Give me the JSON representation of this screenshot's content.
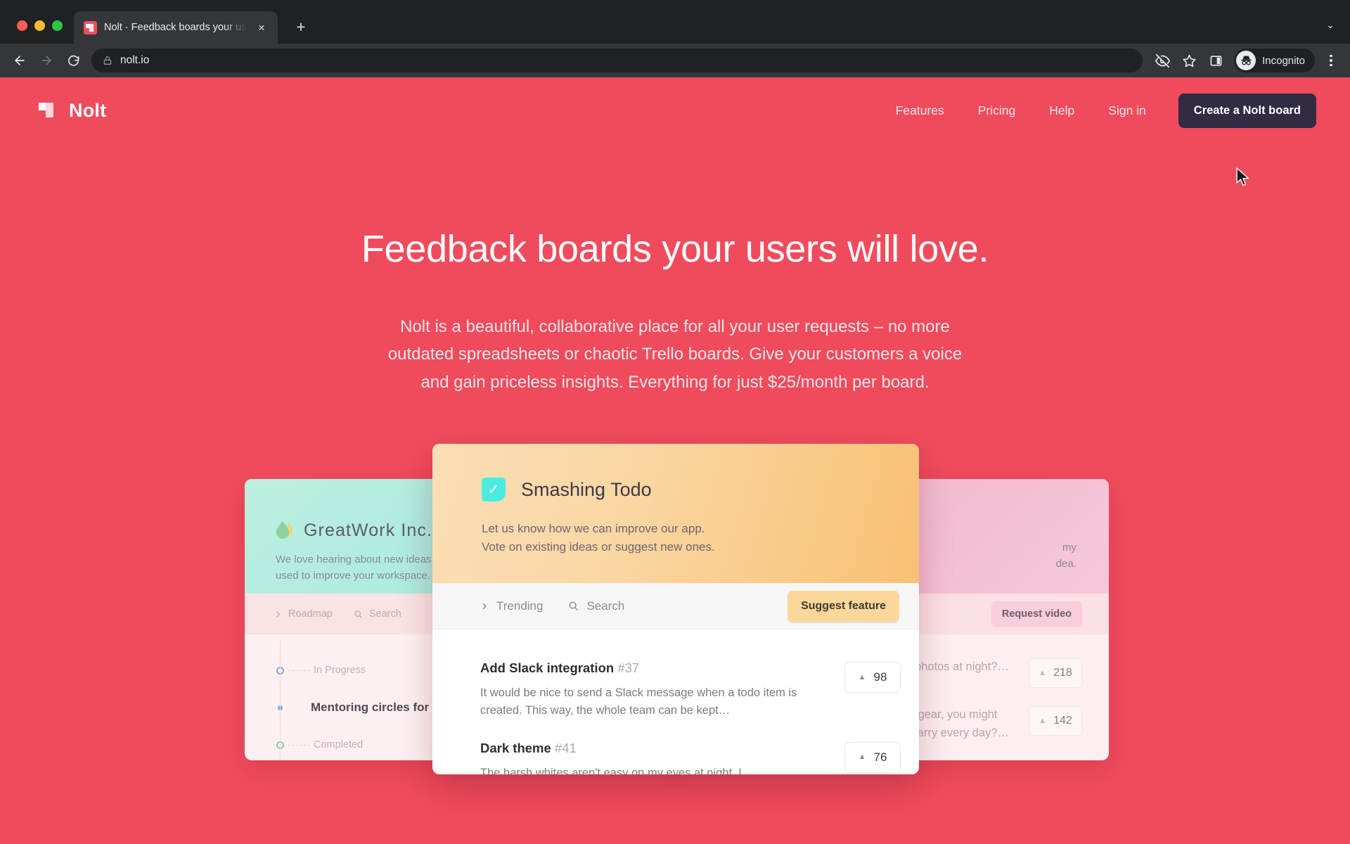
{
  "browser": {
    "tab": {
      "title": "Nolt · Feedback boards your us",
      "favicon": "nolt-favicon",
      "close": "×"
    },
    "new_tab": "+",
    "tab_list_caret": "⌄",
    "omnibox": {
      "url": "nolt.io",
      "lock_icon": "lock-icon"
    },
    "back_icon": "back-arrow-icon",
    "forward_icon": "forward-arrow-icon",
    "reload_icon": "reload-icon",
    "tracking_icon": "eye-slash-icon",
    "bookmark_icon": "star-icon",
    "side_panel_icon": "side-panel-icon",
    "profile": {
      "label": "Incognito",
      "avatar_icon": "incognito-avatar-icon"
    },
    "menu_icon": "kebab-menu-icon"
  },
  "site": {
    "brand": "Nolt",
    "nav": [
      {
        "label": "Features"
      },
      {
        "label": "Pricing"
      },
      {
        "label": "Help"
      },
      {
        "label": "Sign in"
      }
    ],
    "cta": "Create a Nolt board",
    "hero": {
      "heading": "Feedback boards your users will love.",
      "subheading": "Nolt is a beautiful, collaborative place for all your user requests – no more outdated spreadsheets or chaotic Trello boards. Give your customers a voice and gain priceless insights. Everything for just $25/month per board."
    },
    "colors": {
      "background": "#ef4b5d",
      "cta_background": "#332a44",
      "center_card_header": "#f9ca86",
      "left_card_header": "#b0ecdf",
      "right_card_header": "#f4bfd4"
    }
  },
  "left_board": {
    "title": "GreatWork Inc.",
    "logo_icon": "leaf-drop-icon",
    "description": "We love hearing about new ideas th\nused to improve your workspace.",
    "toolbar": [
      {
        "label": "Roadmap",
        "icon": "chevron-right-icon"
      },
      {
        "label": "Search",
        "icon": "search-icon"
      }
    ],
    "timeline": [
      {
        "type": "stage",
        "label": "In Progress",
        "dot_color": "#7ea9d6"
      },
      {
        "type": "item",
        "label": "Mentoring circles for coll"
      },
      {
        "type": "stage",
        "label": "Completed",
        "dot_color": "#8fcfa5"
      }
    ]
  },
  "center_board": {
    "title": "Smashing Todo",
    "logo_icon": "check-badge-icon",
    "description_line1": "Let us know how we can improve our app.",
    "description_line2": "Vote on existing ideas or suggest new ones.",
    "toolbar": {
      "sort": {
        "label": "Trending",
        "icon": "chevron-right-icon"
      },
      "search": {
        "label": "Search",
        "icon": "search-icon"
      },
      "suggest_button": "Suggest feature"
    },
    "items": [
      {
        "title": "Add Slack integration",
        "number": "#37",
        "description": "It would be nice to send a Slack message when a todo item is created. This way, the whole team can be kept…",
        "votes": "98",
        "vote_icon": "upvote-caret-icon"
      },
      {
        "title": "Dark theme",
        "number": "#41",
        "description": "The harsh whites aren't easy on my eyes at night. I",
        "votes": "76",
        "vote_icon": "upvote-caret-icon"
      }
    ]
  },
  "right_board": {
    "description_line1": "my",
    "description_line2": "dea.",
    "toolbar": {
      "request_button": "Request video"
    },
    "items": [
      {
        "text": "photos at night?…",
        "votes": "218",
        "vote_icon": "upvote-caret-icon"
      },
      {
        "text_line1": "t gear, you might",
        "text_line2": "carry every day?…",
        "votes": "142",
        "vote_icon": "upvote-caret-icon"
      }
    ]
  },
  "cursor": {
    "icon": "mouse-pointer-icon"
  }
}
